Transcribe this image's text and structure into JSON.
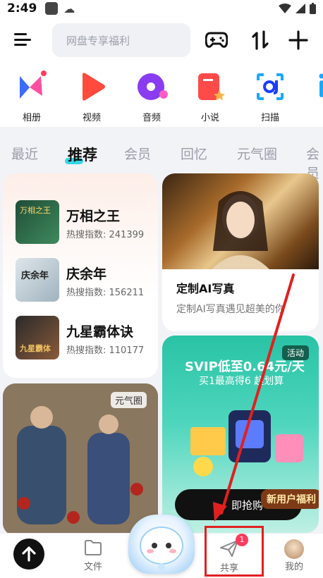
{
  "status": {
    "time": "2:49"
  },
  "header": {
    "search_placeholder": "网盘专享福利"
  },
  "apps": [
    {
      "label": "相册",
      "icon": "album-icon"
    },
    {
      "label": "视频",
      "icon": "video-icon"
    },
    {
      "label": "音频",
      "icon": "audio-icon"
    },
    {
      "label": "小说",
      "icon": "novel-icon"
    },
    {
      "label": "扫描",
      "icon": "scan-icon"
    }
  ],
  "tabs": [
    "最近",
    "推荐",
    "会员",
    "回忆",
    "元气圈",
    "会员"
  ],
  "active_tab": "推荐",
  "hot_list": [
    {
      "title": "万相之王",
      "meta": "热搜指数: 241399",
      "cover_text": "万相之王"
    },
    {
      "title": "庆余年",
      "meta": "热搜指数: 156211",
      "cover_text": "庆余年"
    },
    {
      "title": "九星霸体诀",
      "meta": "热搜指数: 110177",
      "cover_text": "九星霸体"
    }
  ],
  "ai_card": {
    "title": "定制AI写真",
    "subtitle": "定制AI写真遇见超美的你"
  },
  "svip_card": {
    "badge": "活动",
    "title": "SVIP低至0.64元/天",
    "subtitle": "买1最高得6 超划算",
    "button": "即抢购",
    "newuser": "新用户福利"
  },
  "photo_card": {
    "badge": "元气圈"
  },
  "bottom_nav": {
    "files": "文件",
    "share": "共享",
    "mine": "我的",
    "share_badge": "1"
  },
  "colors": {
    "accent": "#35d6e6",
    "annotation": "#e02020",
    "svip": "#29c3a6"
  }
}
